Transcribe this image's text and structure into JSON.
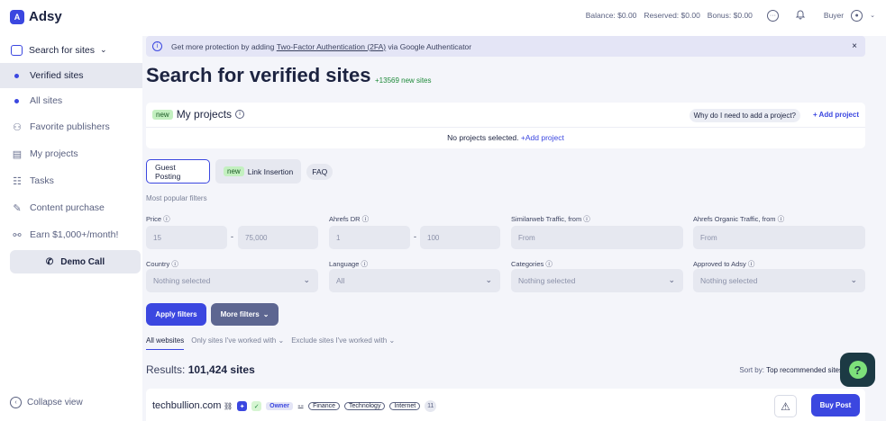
{
  "app": {
    "name": "Adsy",
    "logo_glyph": "A"
  },
  "topbar": {
    "balance": "Balance: $0.00",
    "reserved": "Reserved: $0.00",
    "bonus": "Bonus: $0.00",
    "role": "Buyer"
  },
  "sidebar": {
    "search": "Search for sites",
    "sub": [
      "Verified sites",
      "All sites"
    ],
    "items": [
      "Favorite publishers",
      "My projects",
      "Tasks",
      "Content purchase",
      "Earn $1,000+/month!"
    ],
    "demo": "Demo Call",
    "collapse": "Collapse view"
  },
  "alert": {
    "pre": "Get more protection by adding ",
    "link": "Two-Factor Authentication (2FA)",
    "post": " via Google Authenticator",
    "close": "×"
  },
  "page": {
    "title": "Search for verified sites",
    "new_sites": "+13569 new sites"
  },
  "projects": {
    "badge": "new",
    "title": "My projects",
    "why": "Why do I need to add a project?",
    "add": "Add project",
    "none": "No projects selected.",
    "none_link": "+Add project"
  },
  "tabs": {
    "guest": "Guest Posting",
    "badge": "new",
    "link": "Link Insertion",
    "faq": "FAQ"
  },
  "filters": {
    "popular": "Most popular filters",
    "price": "Price",
    "price_from": "15",
    "price_to": "75,000",
    "dr": "Ahrefs DR",
    "dr_from": "1",
    "dr_to": "100",
    "sw": "Similarweb Traffic, from",
    "sw_ph": "From",
    "aot": "Ahrefs Organic Traffic, from",
    "aot_ph": "From",
    "country": "Country",
    "country_val": "Nothing selected",
    "language": "Language",
    "language_val": "All",
    "categories": "Categories",
    "categories_val": "Nothing selected",
    "approved": "Approved to Adsy",
    "approved_val": "Nothing selected",
    "dash": "-"
  },
  "buttons": {
    "apply": "Apply filters",
    "more": "More filters"
  },
  "subtabs": [
    "All websites",
    "Only sites I've worked with",
    "Exclude sites I've worked with"
  ],
  "results": {
    "label": "Results:",
    "count": "101,424 sites",
    "sort_label": "Sort by:",
    "sort_val": "Top recommended sites"
  },
  "site": {
    "domain": "techbullion.com",
    "owner": "Owner",
    "cats": [
      "Finance",
      "Technology",
      "Internet"
    ],
    "count": "11",
    "buy": "Buy Post"
  },
  "colors": {
    "accent": "#3b47e0",
    "chat": "#1c3a44",
    "chat_bubble": "#7de07a"
  }
}
